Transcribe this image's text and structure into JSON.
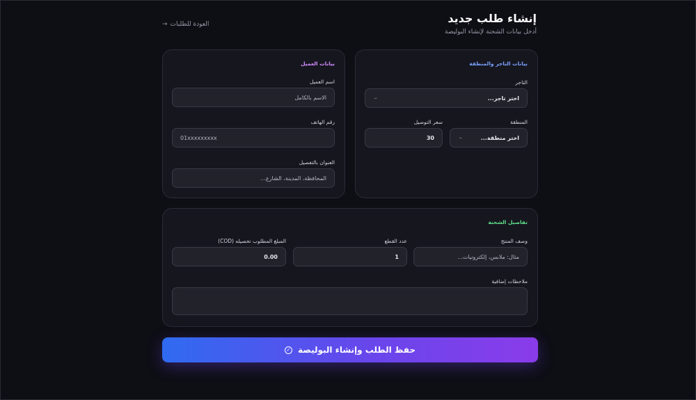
{
  "header": {
    "title": "إنشاء طلب جديد",
    "subtitle": "أدخل بيانات الشحنة لإنشاء البوليصة",
    "back_link": "العودة للطلبات",
    "back_arrow": "→"
  },
  "merchant_card": {
    "title": "بيانات التاجر والمنطقة",
    "title_color": "#7aa2ff",
    "merchant_label": "التاجر",
    "merchant_value": "اختر تاجر...",
    "region_label": "المنطقة",
    "region_value": "اختر منطقة...",
    "delivery_price_label": "سعر التوصيل",
    "delivery_price_value": "30"
  },
  "customer_card": {
    "title": "بيانات العميل",
    "title_color": "#d08cff",
    "name_label": "اسم العميل",
    "name_placeholder": "الاسم بالكامل",
    "phone_label": "رقم الهاتف",
    "phone_placeholder": "01xxxxxxxxx",
    "address_label": "العنوان بالتفصيل",
    "address_placeholder": "المحافظة، المدينة، الشارع..."
  },
  "shipment_card": {
    "title": "تفاصيل الشحنة",
    "title_color": "#5ee08a",
    "product_label": "وصف المنتج",
    "product_placeholder": "مثال: ملابس، إلكترونيات...",
    "pieces_label": "عدد القطع",
    "pieces_value": "1",
    "cod_label": "المبلغ المطلوب تحصيله (COD)",
    "cod_value": "0.00",
    "notes_label": "ملاحظات إضافية",
    "notes_value": ""
  },
  "submit": {
    "label": "حفظ الطلب وإنشاء البوليصة",
    "icon": "check-circle-icon"
  },
  "icons": {
    "chevron": "⌄",
    "check": "✓"
  }
}
